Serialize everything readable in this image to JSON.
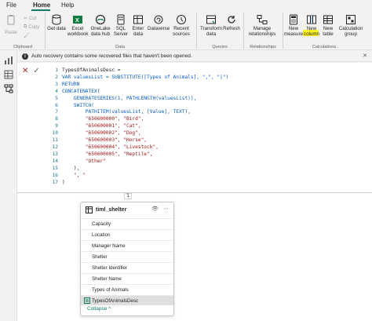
{
  "menu": {
    "tabs": [
      {
        "label": "File"
      },
      {
        "label": "Home"
      },
      {
        "label": "Help"
      }
    ]
  },
  "ribbon": {
    "clipboard": {
      "paste_label": "Paste",
      "cut_label": "Cut",
      "copy_label": "Copy",
      "group_label": "Clipboard"
    },
    "data": {
      "get_data": "Get data",
      "excel_workbook": "Excel workbook",
      "onelake_data_hub": "OneLake data hub",
      "sql_server": "SQL Server",
      "enter_data": "Enter data",
      "dataverse": "Dataverse",
      "recent_sources": "Recent sources",
      "group_label": "Data"
    },
    "queries": {
      "transform_data": "Transform data",
      "refresh": "Refresh",
      "group_label": "Queries"
    },
    "relationships": {
      "manage_relationships": "Manage relationships",
      "group_label": "Relationships"
    },
    "calculations": {
      "new_measure": "New measure",
      "new_column": "New column",
      "new_table": "New table",
      "calculation_group": "Calculation group",
      "group_label": "Calculations"
    },
    "colors": {
      "accent": "#117865",
      "highlight": "#fff200"
    }
  },
  "notice": {
    "text": "Auto recovery contains some recovered files that haven't been opened."
  },
  "formula": {
    "lines": [
      {
        "n": "1",
        "text": "TypesOfAnimalsDesc ="
      },
      {
        "n": "2",
        "text": "VAR valuesList = SUBSTITUTE([Types of Animals], \",\", \"|\")"
      },
      {
        "n": "3",
        "text": "RETURN"
      },
      {
        "n": "4",
        "text": "CONCATENATEX("
      },
      {
        "n": "5",
        "text": "    GENERATESERIES(1, PATHLENGTH(valuesList)),"
      },
      {
        "n": "6",
        "text": "    SWITCH("
      },
      {
        "n": "7",
        "text": "        PATHITEM(valuesList, [Value], TEXT),"
      },
      {
        "n": "8",
        "text": "        \"650600000\", \"Bird\","
      },
      {
        "n": "9",
        "text": "        \"650600001\", \"Cat\","
      },
      {
        "n": "10",
        "text": "        \"650600002\", \"Dog\","
      },
      {
        "n": "11",
        "text": "        \"650600003\", \"Horse\","
      },
      {
        "n": "12",
        "text": "        \"650600004\", \"Livestock\","
      },
      {
        "n": "13",
        "text": "        \"650600005\", \"Reptile\","
      },
      {
        "n": "14",
        "text": "        \"Other\""
      },
      {
        "n": "15",
        "text": "    ),"
      },
      {
        "n": "16",
        "text": "    \", \""
      },
      {
        "n": "17",
        "text": ")"
      }
    ],
    "caret_label": "1"
  },
  "table_card": {
    "title": "timl_shelter",
    "eye_icon": "eye-icon",
    "more_icon": "more-icon",
    "fields": [
      {
        "label": "Capacity"
      },
      {
        "label": "Location"
      },
      {
        "label": "Manager Name"
      },
      {
        "label": "Shelter"
      },
      {
        "label": "Shelter Identifier"
      },
      {
        "label": "Shelter Name"
      },
      {
        "label": "Types of Animals"
      },
      {
        "label": "TypesOfAnimalsDesc"
      }
    ],
    "collapse_label": "Collapse"
  }
}
